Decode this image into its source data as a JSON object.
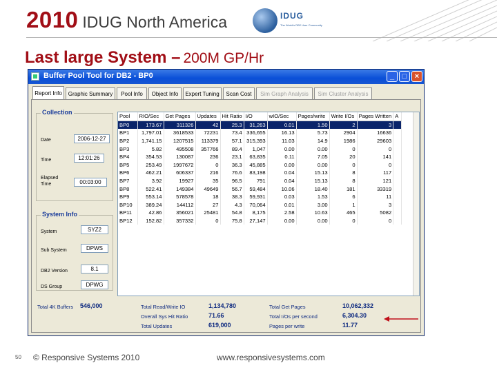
{
  "header": {
    "year": "2010",
    "conference": "IDUG North America",
    "logo_text": "IDUG",
    "logo_tagline": "The World's DB2 User Community"
  },
  "slide": {
    "title_main": "Last large System –",
    "title_sub": "200M GP/Hr"
  },
  "window": {
    "title": "Buffer Pool Tool for DB2 - BP0",
    "buttons": {
      "minimize": "_",
      "maximize": "□",
      "close": "×"
    },
    "tabs": [
      {
        "label": "Report Info",
        "state": "active"
      },
      {
        "label": "Graphic Summary",
        "state": "normal"
      },
      {
        "label": "Pool Info",
        "state": "normal"
      },
      {
        "label": "Object Info",
        "state": "normal"
      },
      {
        "label": "Expert Tuning",
        "state": "normal"
      },
      {
        "label": "Scan Cost",
        "state": "normal"
      },
      {
        "label": "Sim Graph Analysis",
        "state": "disabled"
      },
      {
        "label": "Sim Cluster Analysis",
        "state": "disabled"
      }
    ],
    "collection": {
      "title": "Collection",
      "date_label": "Date",
      "date_value": "2006-12-27",
      "time_label": "Time",
      "time_value": "12:01:26",
      "elapsed_label_1": "Elapsed",
      "elapsed_label_2": "Time",
      "elapsed_value": "00:03:00"
    },
    "system_info": {
      "title": "System Info",
      "system_label": "System",
      "system_value": "SYZ2",
      "subsystem_label": "Sub System",
      "subsystem_value": "DPWS",
      "db2version_label": "DB2 Version",
      "db2version_value": "8.1",
      "dsgroup_label": "DS Group",
      "dsgroup_value": "DPWG"
    },
    "grid": {
      "columns": [
        "Pool",
        "RIO/Sec",
        "Get Pages",
        "Updates",
        "Hit Ratio",
        "I/O",
        "wIO/Sec",
        "Pages/write",
        "Write I/Os",
        "Pages Written",
        "A"
      ],
      "rows": [
        [
          "BP0",
          "173.67",
          "311326",
          "42",
          "25.3",
          "31,263",
          "0.01",
          "1.50",
          "2",
          "3",
          ""
        ],
        [
          "BP1",
          "1,797.01",
          "3618533",
          "72231",
          "73.4",
          "336,655",
          "16.13",
          "5.73",
          "2904",
          "16636",
          ""
        ],
        [
          "BP2",
          "1,741.15",
          "1207515",
          "113379",
          "57.1",
          "315,393",
          "11.03",
          "14.9",
          "1986",
          "29603",
          ""
        ],
        [
          "BP3",
          "5.82",
          "495508",
          "357766",
          "89.4",
          "1,047",
          "0.00",
          "0.00",
          "0",
          "0",
          ""
        ],
        [
          "BP4",
          "354.53",
          "130087",
          "236",
          "23.1",
          "63,835",
          "0.11",
          "7.05",
          "20",
          "141",
          ""
        ],
        [
          "BP5",
          "253.49",
          "1997672",
          "0",
          "36.3",
          "45,885",
          "0.00",
          "0.00",
          "0",
          "0",
          ""
        ],
        [
          "BP6",
          "462.21",
          "606337",
          "216",
          "76.6",
          "83,198",
          "0.04",
          "15.13",
          "8",
          "117",
          ""
        ],
        [
          "BP7",
          "3.92",
          "19927",
          "35",
          "96.5",
          "791",
          "0.04",
          "15.13",
          "8",
          "121",
          ""
        ],
        [
          "BP8",
          "522.41",
          "149384",
          "49649",
          "56.7",
          "59,484",
          "10.06",
          "18.40",
          "181",
          "33319",
          ""
        ],
        [
          "BP9",
          "553.14",
          "578578",
          "18",
          "38.3",
          "59,931",
          "0.03",
          "1.53",
          "6",
          "11",
          ""
        ],
        [
          "BP10",
          "389.24",
          "144112",
          "27",
          "4.3",
          "70,064",
          "0.01",
          "3.00",
          "1",
          "3",
          ""
        ],
        [
          "BP11",
          "42.86",
          "356021",
          "25481",
          "54.8",
          "8,175",
          "2.58",
          "10.63",
          "465",
          "5082",
          ""
        ],
        [
          "BP12",
          "152.82",
          "357332",
          "0",
          "75.8",
          "27,147",
          "0.00",
          "0.00",
          "0",
          "0",
          ""
        ]
      ]
    },
    "totals": {
      "total_4k_label": "Total 4K Buffers",
      "total_4k_value": "546,000",
      "rw_io_label": "Total Read/Write IO",
      "rw_io_value": "1,134,780",
      "hit_ratio_label": "Overall Sys Hit Ratio",
      "hit_ratio_value": "71.66",
      "updates_label": "Total Updates",
      "updates_value": "619,000",
      "get_pages_label": "Total Get Pages",
      "get_pages_value": "10,062,332",
      "io_per_sec_label": "Total I/Os per second",
      "io_per_sec_value": "6,304.30",
      "pages_per_write_label": "Pages per write",
      "pages_per_write_value": "11.77"
    }
  },
  "footer": {
    "page_number": "50",
    "copyright": "© Responsive Systems 2010",
    "url": "www.responsivesystems.com"
  },
  "colors": {
    "title_red": "#a10e16",
    "xp_titlebar": "#0a4fd8",
    "selection": "#0a246a",
    "arrow": "#c0101a"
  }
}
